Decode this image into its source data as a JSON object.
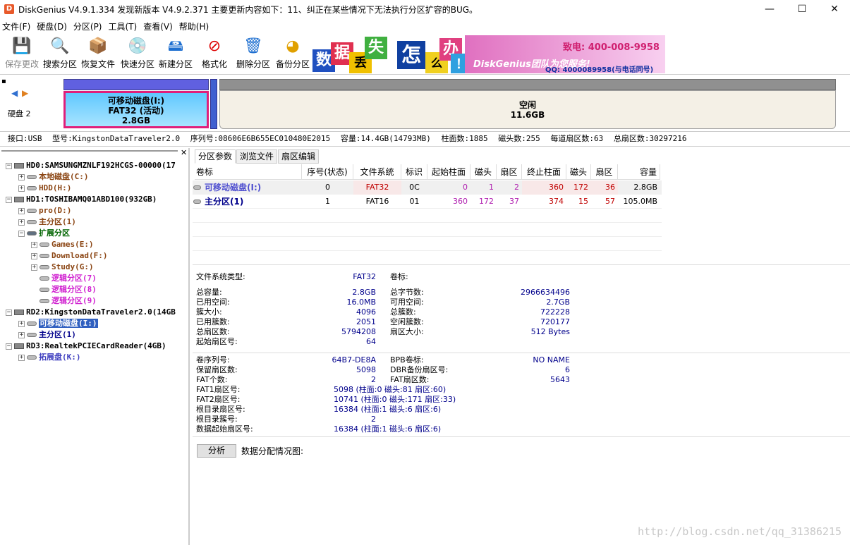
{
  "titlebar": {
    "title": "DiskGenius V4.9.1.334   发现新版本 V4.9.2.371 主要更新内容如下：11、纠正在某些情况下无法执行分区扩容的BUG。",
    "minimize": "—",
    "maximize": "☐",
    "close": "✕"
  },
  "menu": [
    "文件(F)",
    "硬盘(D)",
    "分区(P)",
    "工具(T)",
    "查看(V)",
    "帮助(H)"
  ],
  "toolbar": [
    {
      "label": "保存更改",
      "icon": "save-icon",
      "glyph": "💾"
    },
    {
      "label": "搜索分区",
      "icon": "search-icon",
      "glyph": "🔍"
    },
    {
      "label": "恢复文件",
      "icon": "restore-icon",
      "glyph": "📦"
    },
    {
      "label": "快速分区",
      "icon": "quick-partition-icon",
      "glyph": "💿"
    },
    {
      "label": "新建分区",
      "icon": "new-partition-icon",
      "glyph": "🖴"
    },
    {
      "label": "格式化",
      "icon": "format-icon",
      "glyph": "⊘"
    },
    {
      "label": "删除分区",
      "icon": "delete-icon",
      "glyph": "🗑"
    },
    {
      "label": "备份分区",
      "icon": "backup-icon",
      "glyph": "◕"
    }
  ],
  "banner": {
    "chars": [
      "数",
      "据",
      "丢",
      "失",
      "怎",
      "么",
      "办",
      "！"
    ],
    "brand": "DiskGenius团队为您服务!",
    "phone": "致电: 400-008-9958",
    "qq": "QQ: 4000089958(与电话同号)"
  },
  "diskmap": {
    "disk_label": "硬盘 2",
    "part1": {
      "name": "可移动磁盘(I:)",
      "fs": "FAT32 (活动)",
      "size": "2.8GB"
    },
    "free": {
      "name": "空闲",
      "size": "11.6GB"
    }
  },
  "diskinfo": {
    "interface": "接口:USB",
    "model": "型号:KingstonDataTraveler2.0",
    "serial": "序列号:08606E6B655EC010480E2015",
    "capacity": "容量:14.4GB(14793MB)",
    "cylinders": "柱面数:1885",
    "heads": "磁头数:255",
    "sectors_per_track": "每道扇区数:63",
    "total_sectors": "总扇区数:30297216"
  },
  "tree": [
    {
      "label": "HD0:SAMSUNGMZNLF192HCGS-00000(17",
      "level": 0,
      "type": "disk",
      "exp": "−",
      "color": "#000"
    },
    {
      "label": "本地磁盘(C:)",
      "level": 1,
      "type": "part",
      "exp": "+",
      "color": "#8b4513"
    },
    {
      "label": "HDD(H:)",
      "level": 1,
      "type": "part",
      "exp": "+",
      "color": "#8b4513"
    },
    {
      "label": "HD1:TOSHIBAMQ01ABD100(932GB)",
      "level": 0,
      "type": "disk",
      "exp": "−",
      "color": "#000"
    },
    {
      "label": "pro(D:)",
      "level": 1,
      "type": "part",
      "exp": "+",
      "color": "#8b4513"
    },
    {
      "label": "主分区(1)",
      "level": 1,
      "type": "part",
      "exp": "+",
      "color": "#8b4513"
    },
    {
      "label": "扩展分区",
      "level": 1,
      "type": "ext",
      "exp": "−",
      "color": "#006400"
    },
    {
      "label": "Games(E:)",
      "level": 2,
      "type": "part",
      "exp": "+",
      "color": "#8b4513"
    },
    {
      "label": "Download(F:)",
      "level": 2,
      "type": "part",
      "exp": "+",
      "color": "#8b4513"
    },
    {
      "label": "Study(G:)",
      "level": 2,
      "type": "part",
      "exp": "+",
      "color": "#8b4513"
    },
    {
      "label": "逻辑分区(7)",
      "level": 2,
      "type": "part",
      "exp": "",
      "color": "#d020d0"
    },
    {
      "label": "逻辑分区(8)",
      "level": 2,
      "type": "part",
      "exp": "",
      "color": "#d020d0"
    },
    {
      "label": "逻辑分区(9)",
      "level": 2,
      "type": "part",
      "exp": "",
      "color": "#d020d0"
    },
    {
      "label": "RD2:KingstonDataTraveler2.0(14GB",
      "level": 0,
      "type": "disk",
      "exp": "−",
      "color": "#000"
    },
    {
      "label": "可移动磁盘(I:)",
      "level": 1,
      "type": "part",
      "exp": "+",
      "color": "#fff",
      "selected": true
    },
    {
      "label": "主分区(1)",
      "level": 1,
      "type": "part",
      "exp": "+",
      "color": "#00008b"
    },
    {
      "label": "RD3:RealtekPCIECardReader(4GB)",
      "level": 0,
      "type": "disk",
      "exp": "−",
      "color": "#000"
    },
    {
      "label": "拓展盘(K:)",
      "level": 1,
      "type": "part",
      "exp": "+",
      "color": "#4040c0"
    }
  ],
  "tabs": [
    "分区参数",
    "浏览文件",
    "扇区编辑"
  ],
  "table": {
    "headers": [
      "卷标",
      "序号(状态)",
      "文件系统",
      "标识",
      "起始柱面",
      "磁头",
      "扇区",
      "终止柱面",
      "磁头",
      "扇区",
      "容量"
    ],
    "rows": [
      [
        "可移动磁盘(I:)",
        "0",
        "FAT32",
        "0C",
        "0",
        "1",
        "2",
        "360",
        "172",
        "36",
        "2.8GB"
      ],
      [
        "主分区(1)",
        "1",
        "FAT16",
        "01",
        "360",
        "172",
        "37",
        "374",
        "15",
        "57",
        "105.0MB"
      ]
    ]
  },
  "params": {
    "fs_type_label": "文件系统类型:",
    "fs_type": "FAT32",
    "volume_label": "卷标:",
    "left1": [
      [
        "总容量:",
        "2.8GB"
      ],
      [
        "已用空间:",
        "16.0MB"
      ],
      [
        "簇大小:",
        "4096"
      ],
      [
        "已用簇数:",
        "2051"
      ],
      [
        "总扇区数:",
        "5794208"
      ],
      [
        "起始扇区号:",
        "64"
      ]
    ],
    "right1": [
      [
        "总字节数:",
        "2966634496"
      ],
      [
        "可用空间:",
        "2.7GB"
      ],
      [
        "总簇数:",
        "722228"
      ],
      [
        "空闲簇数:",
        "720177"
      ],
      [
        "扇区大小:",
        "512 Bytes"
      ]
    ],
    "left2": [
      [
        "卷序列号:",
        "64B7-DE8A"
      ],
      [
        "保留扇区数:",
        "5098"
      ],
      [
        "FAT个数:",
        "2"
      ],
      [
        "FAT1扇区号:",
        "5098 (柱面:0 磁头:81 扇区:60)"
      ],
      [
        "FAT2扇区号:",
        "10741 (柱面:0 磁头:171 扇区:33)"
      ],
      [
        "根目录扇区号:",
        "16384 (柱面:1 磁头:6 扇区:6)"
      ],
      [
        "根目录簇号:",
        "2"
      ],
      [
        "数据起始扇区号:",
        "16384 (柱面:1 磁头:6 扇区:6)"
      ]
    ],
    "right2": [
      [
        "BPB卷标:",
        "NO NAME"
      ],
      [
        "DBR备份扇区号:",
        "6"
      ],
      [
        "FAT扇区数:",
        "5643"
      ]
    ],
    "analyze_button": "分析",
    "alloc_label": "数据分配情况图:"
  },
  "watermark": "http://blog.csdn.net/qq_31386215"
}
